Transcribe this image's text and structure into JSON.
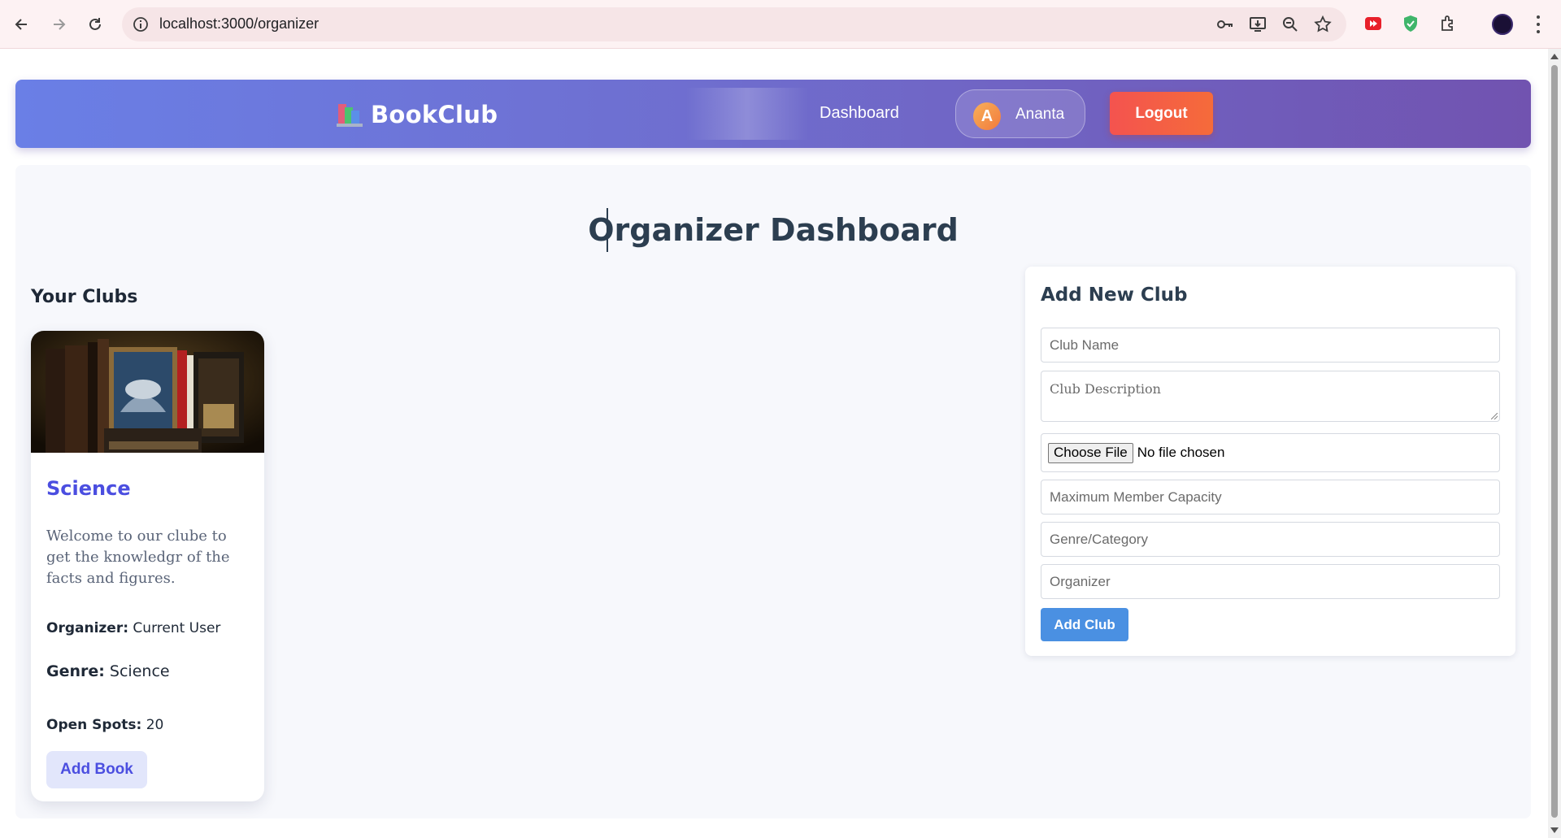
{
  "browser": {
    "url": "localhost:3000/organizer"
  },
  "header": {
    "brand": "BookClub",
    "nav_dashboard": "Dashboard",
    "user_initial": "A",
    "user_name": "Ananta",
    "logout_label": "Logout"
  },
  "page": {
    "title": "Organizer Dashboard",
    "clubs_heading": "Your Clubs"
  },
  "club": {
    "name": "Science",
    "description": "Welcome to our clube to get the knowledgr of the facts and figures.",
    "organizer_label": "Organizer:",
    "organizer_value": "Current User",
    "genre_label": "Genre:",
    "genre_value": "Science",
    "spots_label": "Open Spots:",
    "spots_value": "20",
    "add_book_label": "Add Book"
  },
  "form": {
    "title": "Add New Club",
    "club_name_placeholder": "Club Name",
    "club_description_placeholder": "Club Description",
    "choose_file_label": "Choose File",
    "no_file_text": "No file chosen",
    "capacity_placeholder": "Maximum Member Capacity",
    "genre_placeholder": "Genre/Category",
    "organizer_placeholder": "Organizer",
    "submit_label": "Add Club"
  },
  "colors": {
    "header_gradient_start": "#6a7fe6",
    "header_gradient_end": "#7153b0",
    "logout": "#f4534f",
    "club_name": "#4b4ee0",
    "add_club": "#4a90e2"
  }
}
